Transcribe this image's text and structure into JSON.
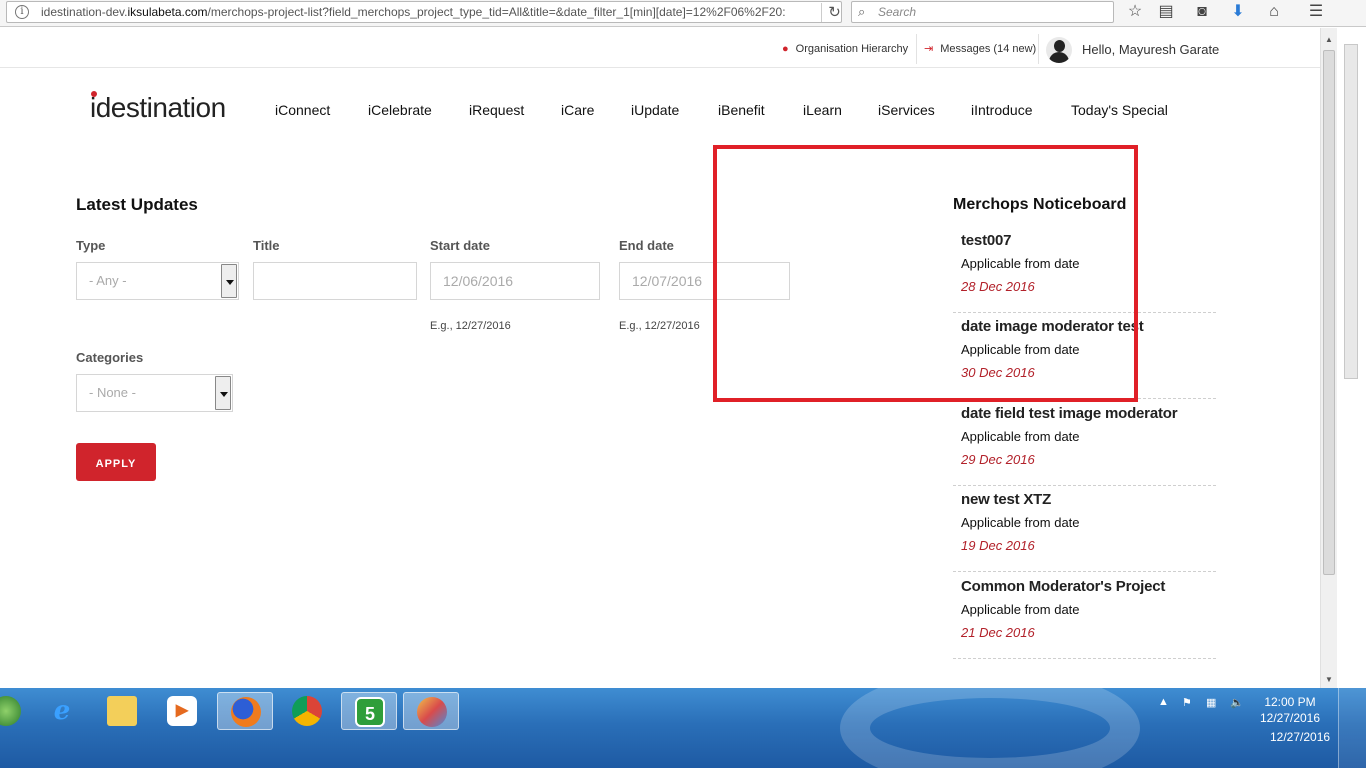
{
  "browser": {
    "url_prefix": "idestination-dev.",
    "url_domain": "iksulabeta.com",
    "url_path": "/merchops-project-list?field_merchops_project_type_tid=All&title=&date_filter_1[min][date]=12%2F06%2F20:",
    "search_placeholder": "Search"
  },
  "topbar": {
    "org_hierarchy": "Organisation Hierarchy",
    "messages": "Messages (14 new)",
    "greeting": "Hello, Mayuresh Garate"
  },
  "logo": "idestination",
  "nav": [
    "iConnect",
    "iCelebrate",
    "iRequest",
    "iCare",
    "iUpdate",
    "iBenefit",
    "iLearn",
    "iServices",
    "iIntroduce",
    "Today's Special"
  ],
  "latest_updates": {
    "title": "Latest Updates",
    "type_label": "Type",
    "type_value": "- Any -",
    "title_label": "Title",
    "title_value": "",
    "start_label": "Start date",
    "start_value": "12/06/2016",
    "start_hint": "E.g., 12/27/2016",
    "end_label": "End date",
    "end_value": "12/07/2016",
    "end_hint": "E.g., 12/27/2016",
    "categories_label": "Categories",
    "categories_value": "- None -",
    "apply_label": "APPLY"
  },
  "noticeboard": {
    "title": "Merchops Noticeboard",
    "items": [
      {
        "title": "test007",
        "sub": "Applicable from date",
        "date": "28 Dec 2016"
      },
      {
        "title": "date image moderator test",
        "sub": "Applicable from date",
        "date": "30 Dec 2016"
      },
      {
        "title": "date field test image moderator",
        "sub": "Applicable from date",
        "date": "29 Dec 2016"
      },
      {
        "title": "new test XTZ",
        "sub": "Applicable from date",
        "date": "19 Dec 2016"
      },
      {
        "title": "Common Moderator's Project",
        "sub": "Applicable from date",
        "date": "21 Dec 2016"
      }
    ]
  },
  "taskbar": {
    "time": "12:00 PM",
    "date": "12/27/2016",
    "date_echo": "12/27/2016"
  },
  "colors": {
    "accent": "#d0242c",
    "highlight_box": "#e02027"
  }
}
